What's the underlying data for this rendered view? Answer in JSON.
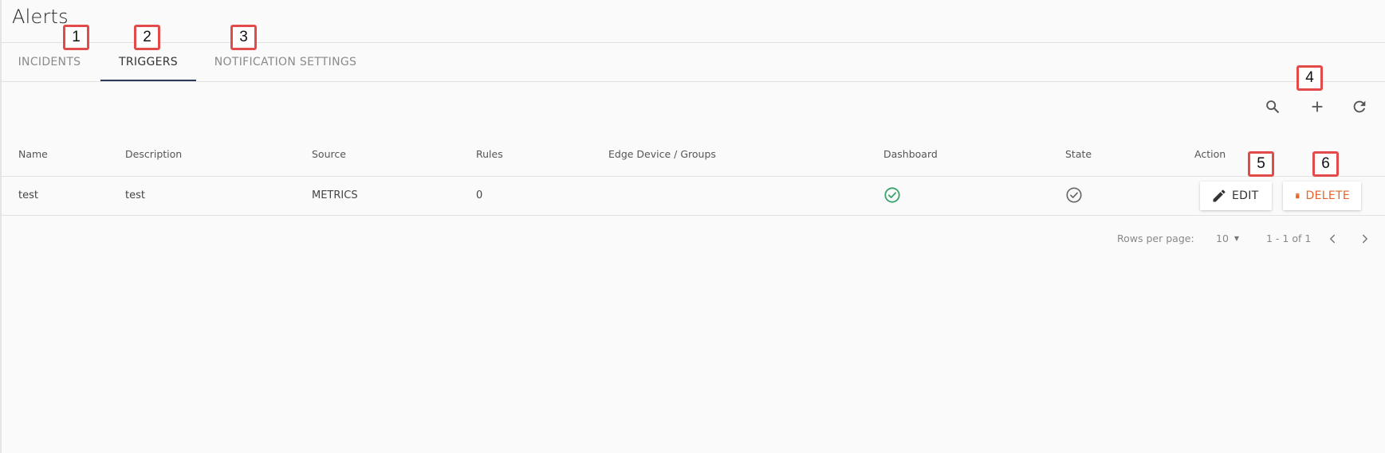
{
  "page": {
    "title": "Alerts"
  },
  "tabs": [
    {
      "label": "INCIDENTS",
      "active": false
    },
    {
      "label": "TRIGGERS",
      "active": true
    },
    {
      "label": "NOTIFICATION SETTINGS",
      "active": false
    }
  ],
  "toolbar": {
    "icons": [
      "search-icon",
      "plus-icon",
      "refresh-icon"
    ]
  },
  "table": {
    "columns": [
      "Name",
      "Description",
      "Source",
      "Rules",
      "Edge Device / Groups",
      "Dashboard",
      "State",
      "Action"
    ],
    "rows": [
      {
        "name": "test",
        "description": "test",
        "source": "METRICS",
        "rules": "0",
        "edge_device_groups": "",
        "dashboard": "check-circle-icon",
        "state": "check-circle-outline-icon"
      }
    ]
  },
  "actions": {
    "edit_label": "EDIT",
    "delete_label": "DELETE"
  },
  "pagination": {
    "rows_per_page_label": "Rows per page:",
    "rows_per_page_value": "10",
    "range": "1 - 1 of 1"
  },
  "annotations": [
    "1",
    "2",
    "3",
    "4",
    "5",
    "6"
  ],
  "colors": {
    "tab_indicator": "#2d3a58",
    "delete": "#e8642a",
    "dashboard_check": "#3aa26b",
    "badge_border": "#e34b4b"
  }
}
